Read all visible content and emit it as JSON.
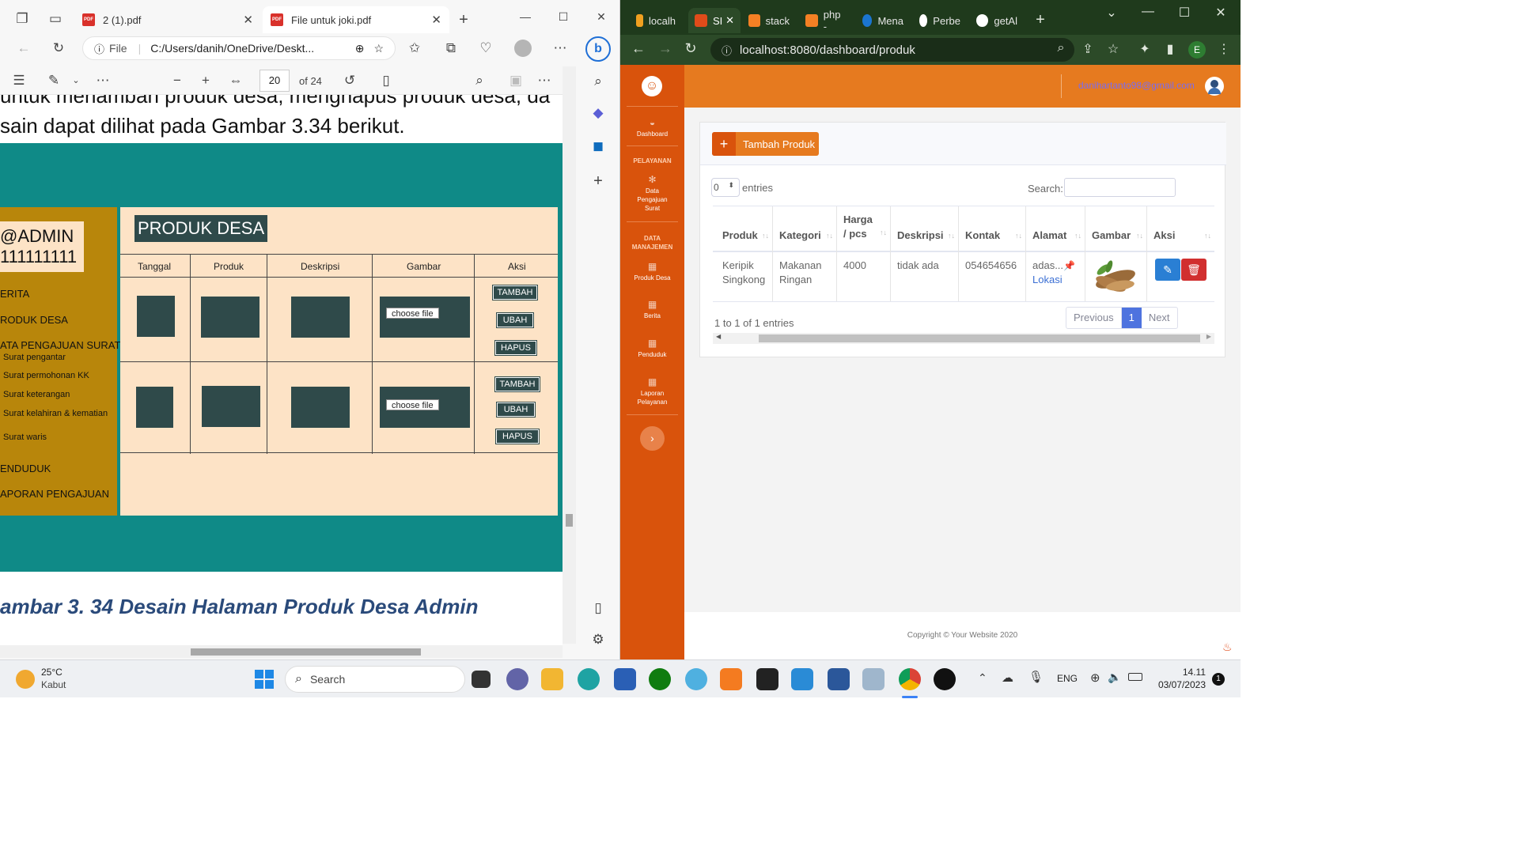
{
  "edge": {
    "tabs": [
      {
        "label": "2 (1).pdf"
      },
      {
        "label": "File untuk joki.pdf"
      }
    ],
    "address": {
      "prefix": "File",
      "path": "C:/Users/danih/OneDrive/Deskt..."
    },
    "pdf": {
      "page_current": "20",
      "page_total": "of 24",
      "text_top_partial": "untuk menambah produk desa, menghapus produk desa, da",
      "text_line": "sain dapat dilihat pada Gambar 3.34 berikut.",
      "caption": "ambar 3. 34 Desain Halaman Produk Desa Admin",
      "mock": {
        "admin_name": "@ADMIN",
        "admin_id": "111111111",
        "menu": [
          "ERITA",
          "RODUK DESA",
          "ATA PENGAJUAN SURAT"
        ],
        "submenu": [
          "Surat pengantar",
          "Surat permohonan KK",
          "Surat keterangan",
          "Surat kelahiran & kematian",
          "Surat waris"
        ],
        "menu_bottom": [
          "ENDUDUK",
          "APORAN PENGAJUAN"
        ],
        "title": "PRODUK DESA",
        "headers": [
          "Tanggal",
          "Produk",
          "Deskripsi",
          "Gambar",
          "Aksi"
        ],
        "choose_file": "choose file",
        "actions": [
          "TAMBAH",
          "UBAH",
          "HAPUS"
        ]
      }
    }
  },
  "chrome": {
    "tabs": [
      "localh",
      "SI",
      "stack",
      "php -",
      "Mena",
      "Perbe",
      "getAl"
    ],
    "address": "localhost:8080/dashboard/produk",
    "profile_letter": "E"
  },
  "web": {
    "user_email": "danihartanto98@gmail.com",
    "sidebar": {
      "dashboard": "Dashboard",
      "section1": "PELAYANAN",
      "pengajuan": "Data Pengajuan Surat",
      "section2": "DATA MANAJEMEN",
      "produk": "Produk Desa",
      "berita": "Berita",
      "penduduk": "Penduduk",
      "laporan": "Laporan Pelayanan"
    },
    "add_button": "Tambah Produk",
    "entries_value": "0",
    "entries_label": "entries",
    "search_label": "Search:",
    "table": {
      "headers": [
        "Produk",
        "Kategori",
        "Harga / pcs",
        "Deskripsi",
        "Kontak",
        "Alamat",
        "Gambar",
        "Aksi"
      ],
      "row": {
        "produk": "Keripik Singkong",
        "kategori": "Makanan Ringan",
        "harga": "4000",
        "deskripsi": "tidak ada",
        "kontak": "054654656",
        "alamat": "adas...",
        "lokasi": "Lokasi"
      }
    },
    "info": "1 to 1 of 1 entries",
    "pagination": {
      "previous": "Previous",
      "page": "1",
      "next": "Next"
    },
    "footer": "Copyright © Your Website 2020"
  },
  "taskbar": {
    "weather_temp": "25°C",
    "weather_desc": "Kabut",
    "search": "Search",
    "lang": "ENG",
    "time": "14.11",
    "date": "03/07/2023",
    "badge": "1"
  }
}
